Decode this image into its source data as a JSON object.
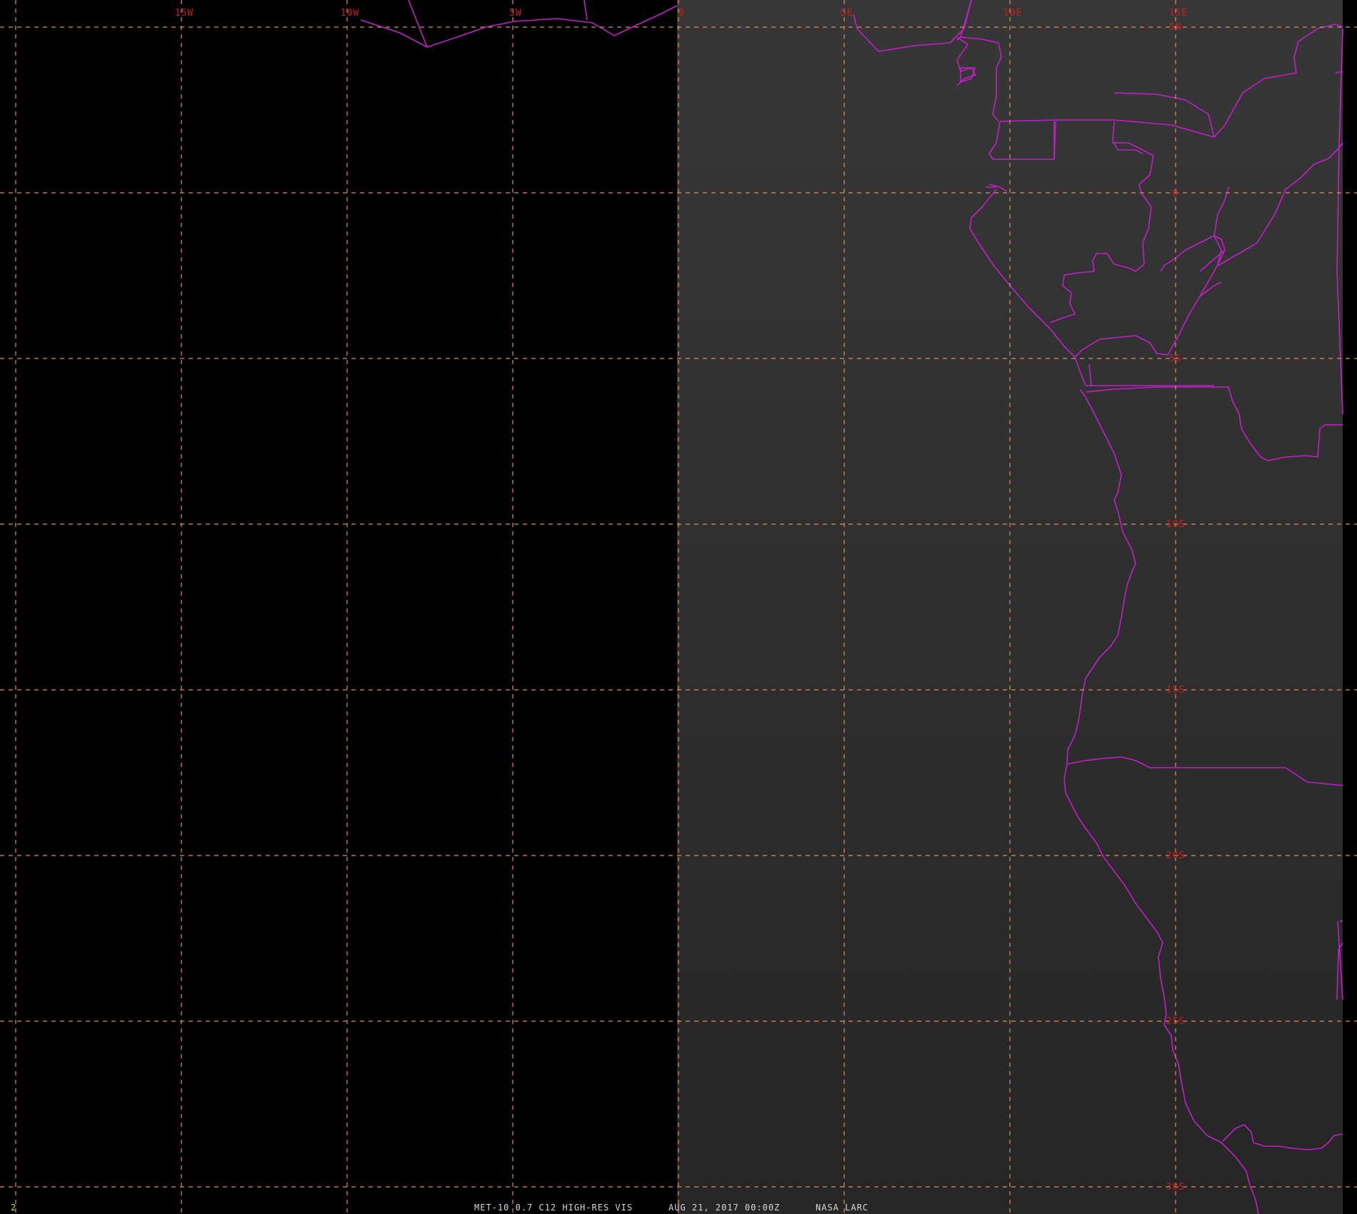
{
  "grid": {
    "longitude_labels": [
      "15W",
      "10W",
      "5W",
      "0",
      "5E",
      "10E",
      "15E"
    ],
    "latitude_labels": [
      "5N",
      "0",
      "5S",
      "10S",
      "15S",
      "20S",
      "25S",
      "30S"
    ]
  },
  "colors": {
    "background": "#000000",
    "data_region": "#303030",
    "grid": "#d9905a",
    "labels": "#c81e1e",
    "coastlines": "#c21fc8",
    "frame_number": "#e0e000",
    "footer_text": "#d8d8d8"
  },
  "footer": {
    "frame_number": "2",
    "product": "MET-10 0.7 C12 HIGH-RES VIS",
    "datetime": "AUG 21, 2017 00:00Z",
    "source": "NASA LARC"
  }
}
